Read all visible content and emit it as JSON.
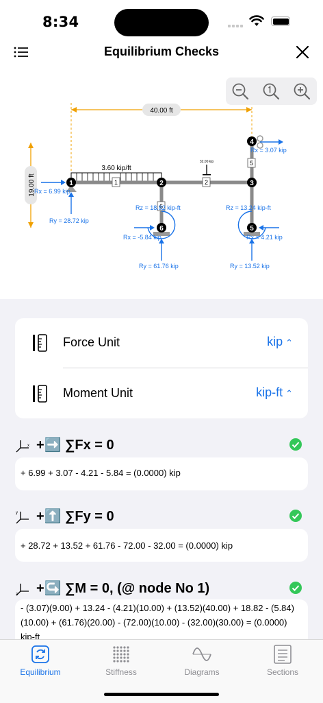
{
  "status": {
    "time": "8:34"
  },
  "nav": {
    "title": "Equilibrium Checks"
  },
  "diagram": {
    "span_dim": "40.00 ft",
    "height_dim": "19.00 ft",
    "dist_load": "3.60 kip/ft",
    "point_load": "32.00 kip",
    "member_labels": [
      "1",
      "2",
      "5",
      "6"
    ],
    "node_labels": [
      "1",
      "2",
      "3",
      "4",
      "5",
      "6"
    ],
    "reactions": {
      "n1_rx": "Rx = 6.99 kip",
      "n1_ry": "Ry = 28.72 kip",
      "n4_rx": "Rx = 3.07 kip",
      "n2_rz": "Rz = 18.82 kip-ft",
      "n6_rx": "Rx = -5.84 kip",
      "n6_ry": "Ry = 61.76 kip",
      "n3_rz": "Rz = 13.24 kip-ft",
      "n5_rx": "Rx = 4.21 kip",
      "n5_ry": "Ry = 13.52 kip"
    }
  },
  "units": {
    "force_label": "Force Unit",
    "force_value": "kip",
    "moment_label": "Moment Unit",
    "moment_value": "kip-ft"
  },
  "equations": {
    "fx": {
      "title": "+➡️ ∑Fx = 0",
      "body": "+ 6.99 + 3.07 - 4.21 - 5.84  =  (0.0000) kip"
    },
    "fy": {
      "title": "+⬆️ ∑Fy = 0",
      "body": "+ 28.72 + 13.52 + 61.76 - 72.00 - 32.00  =  (0.0000) kip"
    },
    "m": {
      "title": "+↪️ ∑M = 0, (@ node No 1)",
      "body": " - (3.07)(9.00) + 13.24 - (4.21)(10.00) + (13.52)(40.00) + 18.82 - (5.84)(10.00) + (61.76)(20.00) - (72.00)(10.00) - (32.00)(30.00)  =  (0.0000) kip-ft"
    }
  },
  "tabs": [
    {
      "label": "Equilibrium",
      "icon": "cycle-arrows-icon"
    },
    {
      "label": "Stiffness",
      "icon": "dot-grid-icon"
    },
    {
      "label": "Diagrams",
      "icon": "sine-wave-icon"
    },
    {
      "label": "Sections",
      "icon": "list-box-icon"
    }
  ],
  "colors": {
    "accent": "#1a73e8",
    "check": "#34c759",
    "reaction": "#1a73e8",
    "dimension": "#f0a000"
  }
}
